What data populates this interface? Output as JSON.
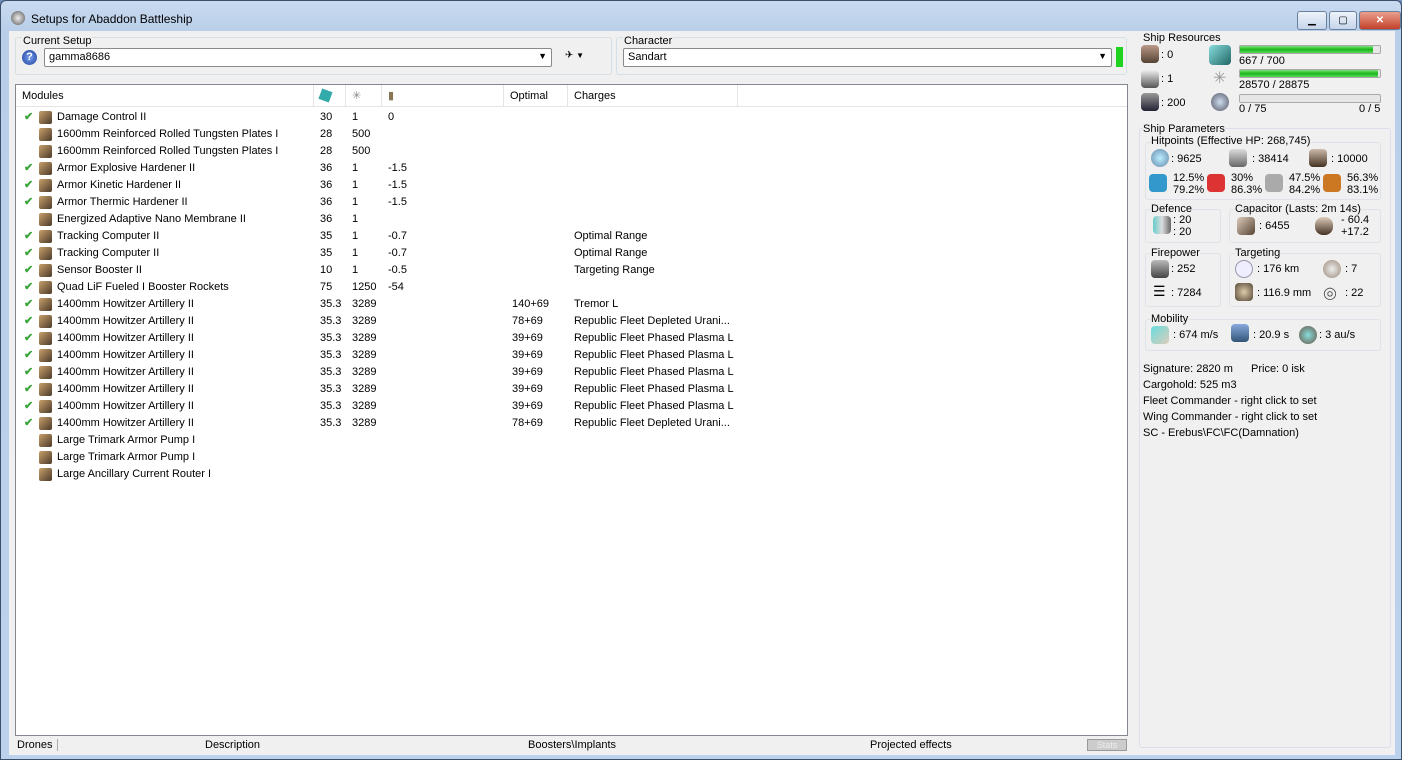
{
  "window": {
    "title": "Setups for Abaddon Battleship",
    "min": "▁",
    "max": "▢",
    "close": "✕"
  },
  "setup": {
    "label": "Current Setup",
    "value": "gamma8686",
    "help": "?"
  },
  "character": {
    "label": "Character",
    "value": "Sandart"
  },
  "columns": [
    "Modules",
    "",
    "",
    "",
    "Optimal",
    "Charges"
  ],
  "modules": [
    {
      "ok": true,
      "name": "Damage Control II",
      "cpu": "30",
      "pg": "1",
      "cap": "0",
      "optimal": "",
      "charge": ""
    },
    {
      "ok": false,
      "name": "1600mm Reinforced Rolled Tungsten Plates I",
      "cpu": "28",
      "pg": "500",
      "cap": "",
      "optimal": "",
      "charge": ""
    },
    {
      "ok": false,
      "name": "1600mm Reinforced Rolled Tungsten Plates I",
      "cpu": "28",
      "pg": "500",
      "cap": "",
      "optimal": "",
      "charge": ""
    },
    {
      "ok": true,
      "name": "Armor Explosive Hardener II",
      "cpu": "36",
      "pg": "1",
      "cap": "-1.5",
      "optimal": "",
      "charge": ""
    },
    {
      "ok": true,
      "name": "Armor Kinetic Hardener II",
      "cpu": "36",
      "pg": "1",
      "cap": "-1.5",
      "optimal": "",
      "charge": ""
    },
    {
      "ok": true,
      "name": "Armor Thermic Hardener II",
      "cpu": "36",
      "pg": "1",
      "cap": "-1.5",
      "optimal": "",
      "charge": ""
    },
    {
      "ok": false,
      "name": "Energized Adaptive Nano Membrane II",
      "cpu": "36",
      "pg": "1",
      "cap": "",
      "optimal": "",
      "charge": ""
    },
    {
      "ok": true,
      "name": "Tracking Computer II",
      "cpu": "35",
      "pg": "1",
      "cap": "-0.7",
      "optimal": "",
      "charge": "Optimal Range"
    },
    {
      "ok": true,
      "name": "Tracking Computer II",
      "cpu": "35",
      "pg": "1",
      "cap": "-0.7",
      "optimal": "",
      "charge": "Optimal Range"
    },
    {
      "ok": true,
      "name": "Sensor Booster II",
      "cpu": "10",
      "pg": "1",
      "cap": "-0.5",
      "optimal": "",
      "charge": "Targeting Range"
    },
    {
      "ok": true,
      "name": "Quad LiF Fueled I Booster Rockets",
      "cpu": "75",
      "pg": "1250",
      "cap": "-54",
      "optimal": "",
      "charge": ""
    },
    {
      "ok": true,
      "name": "1400mm Howitzer Artillery II",
      "cpu": "35.3",
      "pg": "3289",
      "cap": "",
      "optimal": "140+69",
      "charge": "Tremor L"
    },
    {
      "ok": true,
      "name": "1400mm Howitzer Artillery II",
      "cpu": "35.3",
      "pg": "3289",
      "cap": "",
      "optimal": "78+69",
      "charge": "Republic Fleet Depleted Urani..."
    },
    {
      "ok": true,
      "name": "1400mm Howitzer Artillery II",
      "cpu": "35.3",
      "pg": "3289",
      "cap": "",
      "optimal": "39+69",
      "charge": "Republic Fleet Phased Plasma L"
    },
    {
      "ok": true,
      "name": "1400mm Howitzer Artillery II",
      "cpu": "35.3",
      "pg": "3289",
      "cap": "",
      "optimal": "39+69",
      "charge": "Republic Fleet Phased Plasma L"
    },
    {
      "ok": true,
      "name": "1400mm Howitzer Artillery II",
      "cpu": "35.3",
      "pg": "3289",
      "cap": "",
      "optimal": "39+69",
      "charge": "Republic Fleet Phased Plasma L"
    },
    {
      "ok": true,
      "name": "1400mm Howitzer Artillery II",
      "cpu": "35.3",
      "pg": "3289",
      "cap": "",
      "optimal": "39+69",
      "charge": "Republic Fleet Phased Plasma L"
    },
    {
      "ok": true,
      "name": "1400mm Howitzer Artillery II",
      "cpu": "35.3",
      "pg": "3289",
      "cap": "",
      "optimal": "39+69",
      "charge": "Republic Fleet Phased Plasma L"
    },
    {
      "ok": true,
      "name": "1400mm Howitzer Artillery II",
      "cpu": "35.3",
      "pg": "3289",
      "cap": "",
      "optimal": "78+69",
      "charge": "Republic Fleet Depleted Urani..."
    },
    {
      "ok": false,
      "name": "Large Trimark Armor Pump I",
      "cpu": "",
      "pg": "",
      "cap": "",
      "optimal": "",
      "charge": ""
    },
    {
      "ok": false,
      "name": "Large Trimark Armor Pump I",
      "cpu": "",
      "pg": "",
      "cap": "",
      "optimal": "",
      "charge": ""
    },
    {
      "ok": false,
      "name": "Large Ancillary Current Router I",
      "cpu": "",
      "pg": "",
      "cap": "",
      "optimal": "",
      "charge": ""
    }
  ],
  "check": "✔",
  "tabs": {
    "drones": "Drones",
    "description": "Description",
    "boosters": "Boosters\\Implants",
    "projected": "Projected effects",
    "stats": "Stats"
  },
  "resources": {
    "label": "Ship Resources",
    "turrets": ": 0",
    "launchers": ": 1",
    "drone_bay": ": 200",
    "cpu": "667 / 700",
    "cpu_frac": 0.953,
    "pg": "28570 / 28875",
    "pg_frac": 0.989,
    "drone_bw": "0 / 75",
    "drones": "0 / 5",
    "drone_frac": 0
  },
  "params": {
    "label": "Ship Parameters",
    "hp_label": "Hitpoints (Effective HP: 268,745)",
    "shield": ": 9625",
    "armor": ": 38414",
    "structure": ": 10000",
    "resists": [
      [
        "12.5%",
        "79.2%"
      ],
      [
        "30%",
        "86.3%"
      ],
      [
        "47.5%",
        "84.2%"
      ],
      [
        "56.3%",
        "83.1%"
      ]
    ],
    "defence_label": "Defence",
    "def1": ": 20",
    "def2": ": 20",
    "cap_label": "Capacitor (Lasts: 2m 14s)",
    "cap": ": 6455",
    "cap_use": "- 60.4",
    "cap_regen": "+17.2",
    "fire_label": "Firepower",
    "dps": ": 252",
    "volley": ": 7284",
    "target_label": "Targeting",
    "range": ": 176 km",
    "max_targets": ": 7",
    "scan_res": ": 116.9 mm",
    "sensor": ": 22",
    "mob_label": "Mobility",
    "speed": ": 674 m/s",
    "align": ": 20.9 s",
    "warp": ": 3 au/s",
    "signature": "Signature: 2820 m",
    "price": "Price: 0 isk",
    "cargo": "Cargohold: 525 m3",
    "fleet": "Fleet Commander - right click to set",
    "wing": "Wing Commander - right click to set",
    "sc": "SC - Erebus\\FC\\FC(Damnation)"
  }
}
